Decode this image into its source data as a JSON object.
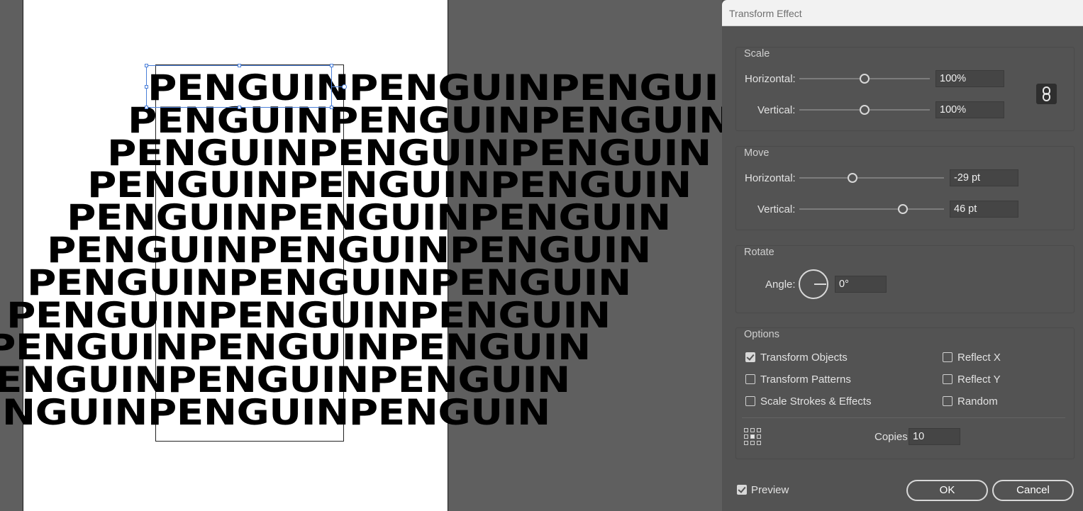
{
  "canvas": {
    "artwork_word": "PENGUIN",
    "repeat": 3,
    "rows": 11
  },
  "dialog": {
    "title": "Transform Effect",
    "scale": {
      "label": "Scale",
      "horizontal_label": "Horizontal:",
      "horizontal_value": "100%",
      "vertical_label": "Vertical:",
      "vertical_value": "100%",
      "link_icon": "chain-link-icon"
    },
    "move": {
      "label": "Move",
      "horizontal_label": "Horizontal:",
      "horizontal_value": "-29 pt",
      "vertical_label": "Vertical:",
      "vertical_value": "46 pt"
    },
    "rotate": {
      "label": "Rotate",
      "angle_label": "Angle:",
      "angle_value": "0°"
    },
    "options": {
      "label": "Options",
      "transform_objects": {
        "label": "Transform Objects",
        "checked": true
      },
      "transform_patterns": {
        "label": "Transform Patterns",
        "checked": false
      },
      "scale_strokes_effects": {
        "label": "Scale Strokes & Effects",
        "checked": false
      },
      "reflect_x": {
        "label": "Reflect X",
        "checked": false
      },
      "reflect_y": {
        "label": "Reflect Y",
        "checked": false
      },
      "random": {
        "label": "Random",
        "checked": false
      },
      "copies_label": "Copies",
      "copies_value": "10"
    },
    "preview": {
      "label": "Preview",
      "checked": true
    },
    "ok_label": "OK",
    "cancel_label": "Cancel"
  }
}
